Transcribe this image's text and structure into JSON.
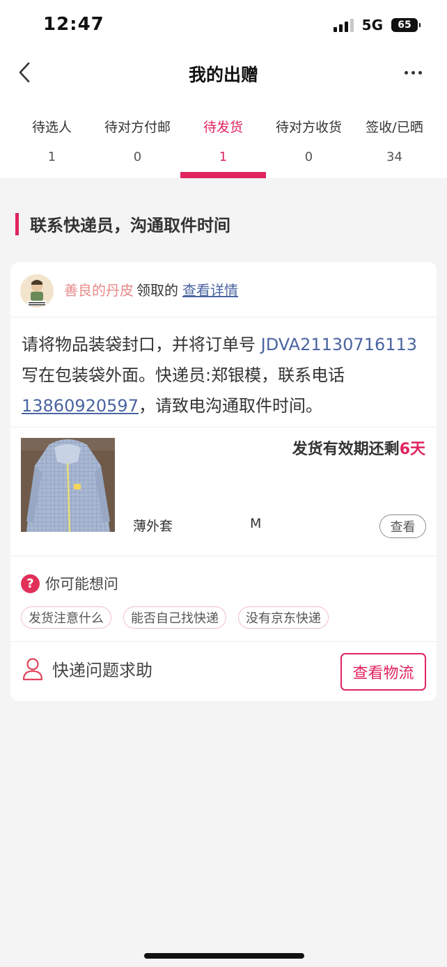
{
  "status_bar": {
    "time": "12:47",
    "network": "5G",
    "battery": "65"
  },
  "nav": {
    "title": "我的出赠",
    "back_icon": "chevron-left-icon",
    "more_icon": "more-dots-icon"
  },
  "tabs": [
    {
      "label": "待选人",
      "count": "1",
      "active": false
    },
    {
      "label": "待对方付邮",
      "count": "0",
      "active": false
    },
    {
      "label": "待发货",
      "count": "1",
      "active": true
    },
    {
      "label": "待对方收货",
      "count": "0",
      "active": false
    },
    {
      "label": "签收/已晒",
      "count": "34",
      "active": false
    }
  ],
  "section": {
    "title": "联系快递员，沟通取件时间"
  },
  "claim": {
    "claimer": "善良的丹皮",
    "verb": "领取的",
    "detail_link": "查看详情"
  },
  "instruction": {
    "part1": "请将物品装袋封口，并将订单号 ",
    "order_no": "JDVA21130716113",
    "part2": " 写在包装袋外面。快递员:郑银模，联系电话",
    "phone": "13860920597",
    "part3": "，请致电沟通取件时间。"
  },
  "product": {
    "expiry_prefix": "发货有效期还剩",
    "expiry_days": "6天",
    "name": "薄外套",
    "size": "M",
    "view_button": "查看"
  },
  "faq": {
    "title": "你可能想问",
    "icon": "question-circle-icon",
    "chips": [
      "发货注意什么",
      "能否自己找快递",
      "没有京东快递"
    ]
  },
  "help": {
    "icon": "person-icon",
    "text": "快递问题求助",
    "logistics_button": "查看物流"
  },
  "colors": {
    "accent": "#e0245e",
    "link": "#4a64a0",
    "claimer": "#e98a8a",
    "background": "#f4f4f5"
  }
}
